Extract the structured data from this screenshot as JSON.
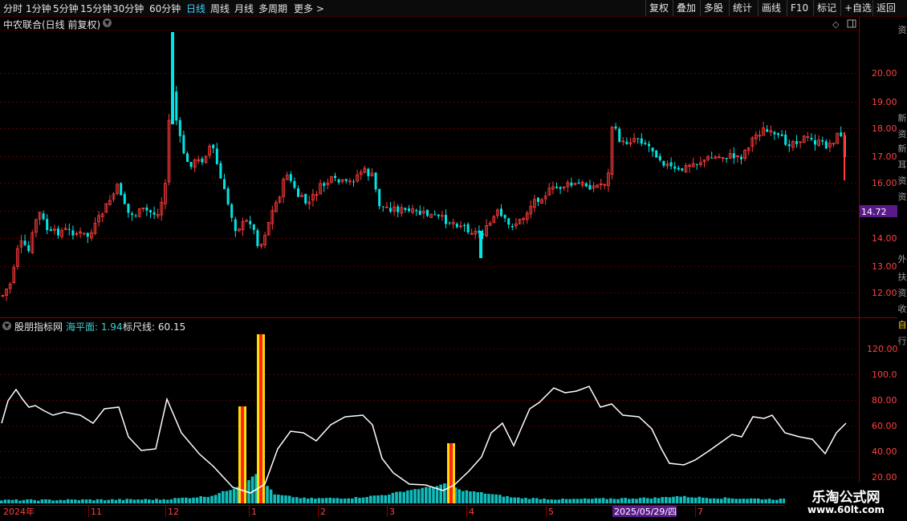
{
  "toolbar": {
    "periods": [
      "分时",
      "1分钟",
      "5分钟",
      "15分钟",
      "30分钟",
      "60分钟",
      "日线",
      "周线",
      "月线",
      "多周期",
      "更多"
    ],
    "active_index": 6,
    "actions": [
      "复权",
      "叠加",
      "多股",
      "统计",
      "画线",
      "F10",
      "标记",
      "+自选",
      "返回"
    ]
  },
  "main_chart": {
    "title": "中农联合(日线 前复权)",
    "price_ticks": [
      "20.00",
      "19.00",
      "18.00",
      "17.00",
      "16.00",
      "14.00",
      "13.00",
      "12.00"
    ],
    "current_price": "14.72"
  },
  "indicator": {
    "name": "股朋指标网",
    "sea_level_label": "海平面: 1.94",
    "ruler_label": "标尺线: 60.15",
    "ticks": [
      "120.00",
      "100.0",
      "80.00",
      "60.00",
      "40.00",
      "20.00"
    ]
  },
  "x_axis": {
    "labels": [
      "2024年",
      "11",
      "12",
      "1",
      "2",
      "3",
      "4",
      "5",
      "2025/05/29/四",
      "7"
    ]
  },
  "right_strip": {
    "glyphs": [
      "资",
      "新",
      "资",
      "新",
      "耳",
      "资",
      "资",
      "外",
      "扶",
      "资",
      "收",
      "自",
      "行"
    ]
  },
  "watermark": {
    "title": "乐淘公式网",
    "url": "www.60lt.com"
  },
  "colors": {
    "up": "#ff3b3b",
    "down": "#00e5e5",
    "grid": "#5a0000",
    "axis_text": "#ff4040",
    "highlight": "#5a1a8a",
    "bar_yellow": "#ffdd00"
  }
}
